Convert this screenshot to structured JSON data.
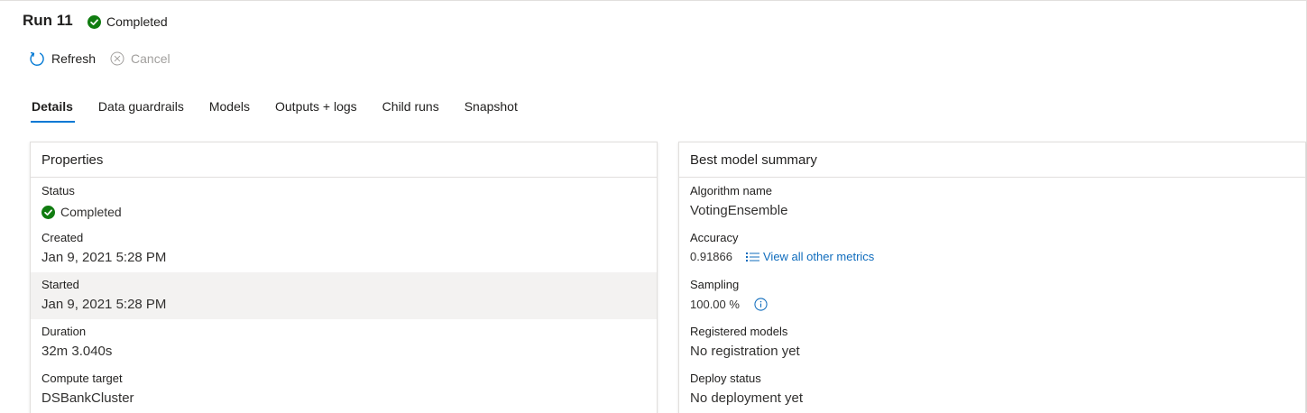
{
  "header": {
    "title": "Run 11",
    "status": "Completed"
  },
  "toolbar": {
    "refresh_label": "Refresh",
    "cancel_label": "Cancel"
  },
  "tabs": [
    {
      "label": "Details",
      "active": true
    },
    {
      "label": "Data guardrails"
    },
    {
      "label": "Models"
    },
    {
      "label": "Outputs + logs"
    },
    {
      "label": "Child runs"
    },
    {
      "label": "Snapshot"
    }
  ],
  "properties": {
    "title": "Properties",
    "status_label": "Status",
    "status_value": "Completed",
    "created_label": "Created",
    "created_value": "Jan 9, 2021 5:28 PM",
    "started_label": "Started",
    "started_value": "Jan 9, 2021 5:28 PM",
    "duration_label": "Duration",
    "duration_value": "32m 3.040s",
    "compute_label": "Compute target",
    "compute_value": "DSBankCluster"
  },
  "summary": {
    "title": "Best model summary",
    "algorithm_label": "Algorithm name",
    "algorithm_value": "VotingEnsemble",
    "accuracy_label": "Accuracy",
    "accuracy_value": "0.91866",
    "metrics_link": "View all other metrics",
    "sampling_label": "Sampling",
    "sampling_value": "100.00 %",
    "registered_label": "Registered models",
    "registered_value": "No registration yet",
    "deploy_label": "Deploy status",
    "deploy_value": "No deployment yet"
  },
  "colors": {
    "accent": "#0078d4",
    "link": "#0f6cbd",
    "success": "#107c10",
    "disabled": "#a19f9d"
  }
}
